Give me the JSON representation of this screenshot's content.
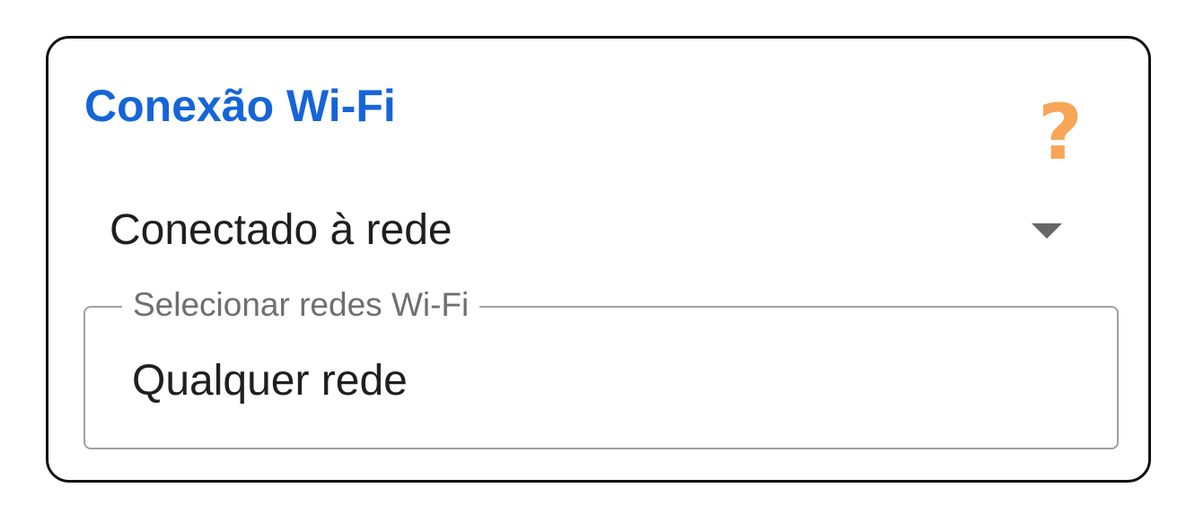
{
  "card": {
    "title": "Conexão Wi-Fi",
    "help_icon": "help-question-icon",
    "help_glyph": "?"
  },
  "connection_dropdown": {
    "selected": "Conectado à rede",
    "icon": "chevron-down-icon"
  },
  "wifi_network_field": {
    "label": "Selecionar redes Wi-Fi",
    "value": "Qualquer rede"
  },
  "colors": {
    "title": "#1565d8",
    "help_icon": "#f7a556",
    "border": "#111111",
    "field_border": "#a0a0a0"
  }
}
